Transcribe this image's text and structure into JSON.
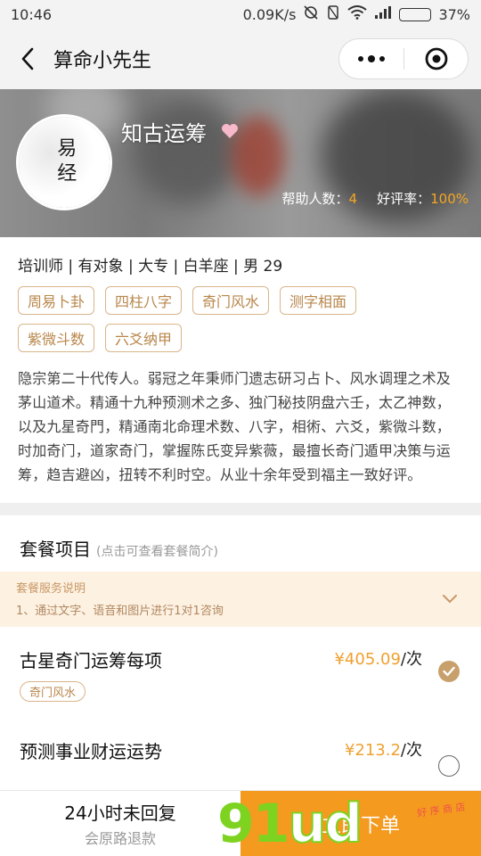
{
  "status_bar": {
    "time": "10:46",
    "net_speed": "0.09K/s",
    "battery": "37%",
    "battery_level": 0.37
  },
  "nav": {
    "title": "算命小先生"
  },
  "master": {
    "name": "知古运筹",
    "avatar_text": "易经",
    "stats": [
      {
        "label": "帮助人数：",
        "value": "4"
      },
      {
        "label": "好评率：",
        "value": "100%"
      }
    ]
  },
  "profile": {
    "line": "培训师 | 有对象 | 大专 | 白羊座 | 男 29",
    "tags": [
      "周易卜卦",
      "四柱八字",
      "奇门风水",
      "测字相面",
      "紫微斗数",
      "六爻纳甲"
    ],
    "bio": "隐宗第二十代传人。弱冠之年秉师门遗志研习占卜、风水调理之术及茅山道术。精通十九种预测术之多、独门秘技阴盘六壬，太乙神数，以及九星奇門，精通南北命理术数、八字，相術、六爻，紫微斗数，时加奇门，道家奇门，掌握陈氏变异紫薇，最擅长奇门遁甲决策与运筹，趋吉避凶，扭转不利时空。从业十余年受到福主一致好评。"
  },
  "packages": {
    "title": "套餐项目",
    "hint": "(点击可查看套餐简介)",
    "notice_title": "套餐服务说明",
    "notice_text": "1、通过文字、语音和图片进行1对1咨询",
    "items": [
      {
        "name": "古星奇门运筹每项",
        "price": "¥405.09",
        "unit": "/次",
        "tag": "奇门风水",
        "selected": true
      },
      {
        "name": "预测事业财运运势",
        "price": "¥213.2",
        "unit": "/次",
        "selected": false
      }
    ]
  },
  "bottom": {
    "line1": "24小时未回复",
    "line2": "会原路退款",
    "order_label": "立即下单"
  },
  "watermark": {
    "a": "91",
    "b": "ud",
    "sub": "好 序 商 店"
  },
  "colors": {
    "accent": "#f39a1f",
    "tag_border": "#d9b58a",
    "tag_text": "#b8864b",
    "price": "#f0a030"
  }
}
